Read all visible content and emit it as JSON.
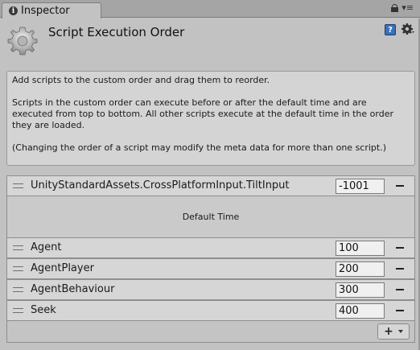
{
  "tab": {
    "title": "Inspector",
    "icon": "info-icon"
  },
  "header": {
    "title": "Script Execution Order",
    "icon": "gear-icon",
    "help_icon": "help-book-icon",
    "settings_icon": "settings-gear-icon"
  },
  "help": {
    "p1": "Add scripts to the custom order and drag them to reorder.",
    "p2": "Scripts in the custom order can execute before or after the default time and are executed from top to bottom. All other scripts execute at the default time in the order they are loaded.",
    "p3": "(Changing the order of a script may modify the meta data for more than one script.)"
  },
  "list": {
    "before_default": [
      {
        "name": "UnityStandardAssets.CrossPlatformInput.TiltInput",
        "order": "-1001"
      }
    ],
    "default_label": "Default Time",
    "after_default": [
      {
        "name": "Agent",
        "order": "100"
      },
      {
        "name": "AgentPlayer",
        "order": "200"
      },
      {
        "name": "AgentBehaviour",
        "order": "300"
      },
      {
        "name": "Seek",
        "order": "400"
      }
    ],
    "add_label": "+"
  },
  "colors": {
    "panel_bg": "#c2c2c2",
    "row_bg": "#d6d6d6",
    "field_bg": "#f0f0f0",
    "help_icon": "#3b6fb8"
  }
}
